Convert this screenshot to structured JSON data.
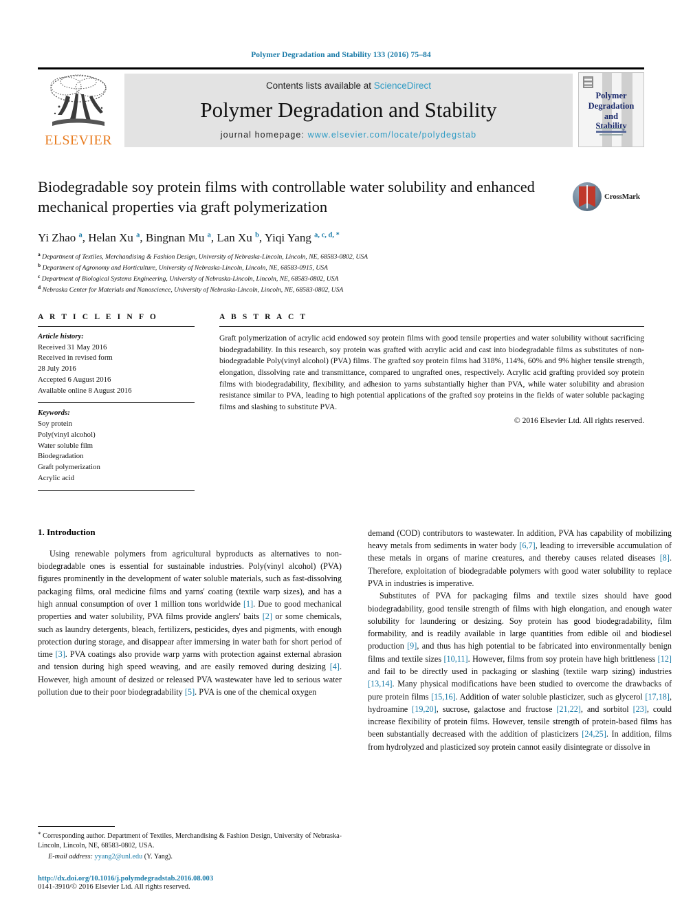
{
  "running_head": "Polymer Degradation and Stability 133 (2016) 75–84",
  "masthead": {
    "contents_prefix": "Contents lists available at ",
    "sciencedirect": "ScienceDirect",
    "journal_title": "Polymer Degradation and Stability",
    "homepage_prefix": "journal homepage: ",
    "homepage_url": "www.elsevier.com/locate/polydegstab",
    "publisher": "ELSEVIER",
    "cover_title": "Polymer\nDegradation\nand\nStability",
    "accent_blue": "#2e9bc4",
    "elsevier_orange": "#e87b1e"
  },
  "title": "Biodegradable soy protein films with controllable water solubility and enhanced mechanical properties via graft polymerization",
  "crossmark_label": "CrossMark",
  "authors": [
    {
      "name": "Yi Zhao",
      "sup": "a"
    },
    {
      "name": "Helan Xu",
      "sup": "a"
    },
    {
      "name": "Bingnan Mu",
      "sup": "a"
    },
    {
      "name": "Lan Xu",
      "sup": "b"
    },
    {
      "name": "Yiqi Yang",
      "sup": "a, c, d, *"
    }
  ],
  "affiliations": [
    {
      "mark": "a",
      "text": "Department of Textiles, Merchandising & Fashion Design, University of Nebraska-Lincoln, Lincoln, NE, 68583-0802, USA"
    },
    {
      "mark": "b",
      "text": "Department of Agronomy and Horticulture, University of Nebraska-Lincoln, Lincoln, NE, 68583-0915, USA"
    },
    {
      "mark": "c",
      "text": "Department of Biological Systems Engineering, University of Nebraska-Lincoln, Lincoln, NE, 68583-0802, USA"
    },
    {
      "mark": "d",
      "text": "Nebraska Center for Materials and Nanoscience, University of Nebraska-Lincoln, Lincoln, NE, 68583-0802, USA"
    }
  ],
  "article_info": {
    "heading": "A R T I C L E  I N F O",
    "history_label": "Article history:",
    "history": [
      "Received 31 May 2016",
      "Received in revised form",
      "28 July 2016",
      "Accepted 6 August 2016",
      "Available online 8 August 2016"
    ],
    "keywords_label": "Keywords:",
    "keywords": [
      "Soy protein",
      "Poly(vinyl alcohol)",
      "Water soluble film",
      "Biodegradation",
      "Graft polymerization",
      "Acrylic acid"
    ]
  },
  "abstract": {
    "heading": "A B S T R A C T",
    "text": "Graft polymerization of acrylic acid endowed soy protein films with good tensile properties and water solubility without sacrificing biodegradability. In this research, soy protein was grafted with acrylic acid and cast into biodegradable films as substitutes of non-biodegradable Poly(vinyl alcohol) (PVA) films. The grafted soy protein films had 318%, 114%, 60% and 9% higher tensile strength, elongation, dissolving rate and transmittance, compared to ungrafted ones, respectively. Acrylic acid grafting provided soy protein films with biodegradability, flexibility, and adhesion to yarns substantially higher than PVA, while water solubility and abrasion resistance similar to PVA, leading to high potential applications of the grafted soy proteins in the fields of water soluble packaging films and slashing to substitute PVA.",
    "copyright": "© 2016 Elsevier Ltd. All rights reserved."
  },
  "introduction": {
    "section_title": "1. Introduction",
    "left_paragraphs": [
      "Using renewable polymers from agricultural byproducts as alternatives to non-biodegradable ones is essential for sustainable industries. Poly(vinyl alcohol) (PVA) figures prominently in the development of water soluble materials, such as fast-dissolving packaging films, oral medicine films and yarns' coating (textile warp sizes), and has a high annual consumption of over 1 million tons worldwide [1]. Due to good mechanical properties and water solubility, PVA films provide anglers' baits [2] or some chemicals, such as laundry detergents, bleach, fertilizers, pesticides, dyes and pigments, with enough protection during storage, and disappear after immersing in water bath for short period of time [3]. PVA coatings also provide warp yarns with protection against external abrasion and tension during high speed weaving, and are easily removed during desizing [4]. However, high amount of desized or released PVA wastewater have led to serious water pollution due to their poor biodegradability [5]. PVA is one of the chemical oxygen"
    ],
    "right_paragraphs": [
      "demand (COD) contributors to wastewater. In addition, PVA has capability of mobilizing heavy metals from sediments in water body [6,7], leading to irreversible accumulation of these metals in organs of marine creatures, and thereby causes related diseases [8]. Therefore, exploitation of biodegradable polymers with good water solubility to replace PVA in industries is imperative.",
      "Substitutes of PVA for packaging films and textile sizes should have good biodegradability, good tensile strength of films with high elongation, and enough water solubility for laundering or desizing. Soy protein has good biodegradability, film formability, and is readily available in large quantities from edible oil and biodiesel production [9], and thus has high potential to be fabricated into environmentally benign films and textile sizes [10,11]. However, films from soy protein have high brittleness [12] and fail to be directly used in packaging or slashing (textile warp sizing) industries [13,14]. Many physical modifications have been studied to overcome the drawbacks of pure protein films [15,16]. Addition of water soluble plasticizer, such as glycerol [17,18], hydroamine [19,20], sucrose, galactose and fructose [21,22], and sorbitol [23], could increase flexibility of protein films. However, tensile strength of protein-based films has been substantially decreased with the addition of plasticizers [24,25]. In addition, films from hydrolyzed and plasticized soy protein cannot easily disintegrate or dissolve in"
    ]
  },
  "footnotes": {
    "corresponding": "Corresponding author. Department of Textiles, Merchandising & Fashion Design, University of Nebraska-Lincoln, Lincoln, NE, 68583-0802, USA.",
    "email_label": "E-mail address:",
    "email": "yyang2@unl.edu",
    "email_suffix": "(Y. Yang).",
    "doi": "http://dx.doi.org/10.1016/j.polymdegradstab.2016.08.003",
    "issn": "0141-3910/© 2016 Elsevier Ltd. All rights reserved."
  }
}
